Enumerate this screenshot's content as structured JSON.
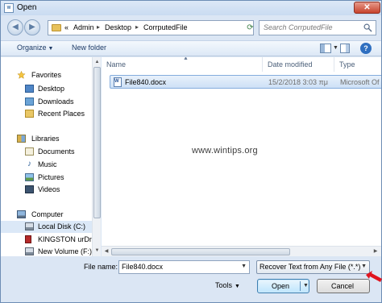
{
  "window": {
    "title": "Open",
    "close_label": "✕"
  },
  "address": {
    "overflow": "«",
    "crumbs": [
      "Admin",
      "Desktop",
      "CorrputedFile"
    ],
    "separator": "▸"
  },
  "search": {
    "placeholder": "Search CorrputedFile"
  },
  "toolbar": {
    "organize_label": "Organize",
    "new_folder_label": "New folder",
    "help_label": "?"
  },
  "sidebar": {
    "items": [
      {
        "label": "Favorites",
        "icon": "star-icon"
      },
      {
        "label": "Desktop",
        "icon": "desktop-icon"
      },
      {
        "label": "Downloads",
        "icon": "downloads-icon"
      },
      {
        "label": "Recent Places",
        "icon": "recent-places-icon"
      },
      {
        "label": "Libraries",
        "icon": "libraries-icon"
      },
      {
        "label": "Documents",
        "icon": "documents-icon"
      },
      {
        "label": "Music",
        "icon": "music-icon"
      },
      {
        "label": "Pictures",
        "icon": "pictures-icon"
      },
      {
        "label": "Videos",
        "icon": "videos-icon"
      },
      {
        "label": "Computer",
        "icon": "computer-icon"
      },
      {
        "label": "Local Disk (C:)",
        "icon": "disk-icon"
      },
      {
        "label": "KINGSTON urDri",
        "icon": "usb-drive-icon"
      },
      {
        "label": "New Volume (F:)",
        "icon": "disk-icon"
      }
    ]
  },
  "filelist": {
    "columns": [
      "Name",
      "Date modified",
      "Type"
    ],
    "rows": [
      {
        "name": "File840.docx",
        "date": "15/2/2018 3:03 πμ",
        "type": "Microsoft Of"
      }
    ]
  },
  "watermark": "www.wintips.org",
  "bottom": {
    "filename_label": "File name:",
    "filename_value": "File840.docx",
    "filter_value": "Recover Text from Any File (*.*)",
    "tools_label": "Tools",
    "open_label": "Open",
    "cancel_label": "Cancel"
  },
  "colors": {
    "accent": "#3c7fb1",
    "selection": "#cde0f6",
    "annotation_arrow": "#e0141e"
  }
}
